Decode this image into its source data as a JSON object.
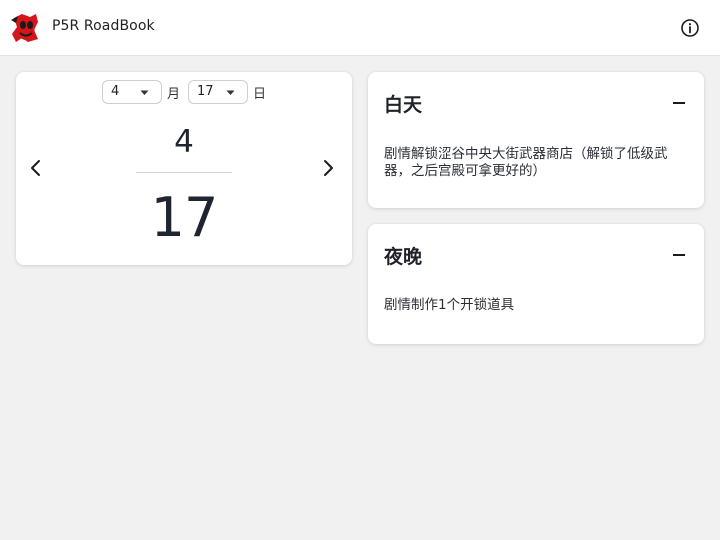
{
  "app": {
    "title": "P5R RoadBook"
  },
  "icons": {
    "logo": "phantom-thieves-calling-card-icon",
    "info": "info-icon",
    "prev": "chevron-left-icon",
    "next": "chevron-right-icon",
    "collapse": "minus-icon",
    "dropdown": "caret-down-icon"
  },
  "colors": {
    "logo_red": "#d5151a",
    "logo_dark": "#1b1b1b",
    "background": "#f1f1f1",
    "card": "#ffffff"
  },
  "date_picker": {
    "month_value": "4",
    "month_unit": "月",
    "day_value": "17",
    "day_unit": "日",
    "display_month": "4",
    "display_day": "17"
  },
  "sections": {
    "daytime": {
      "title": "白天",
      "text": "剧情解锁涩谷中央大街武器商店（解锁了低级武器，之后宫殿可拿更好的）"
    },
    "night": {
      "title": "夜晚",
      "text": "剧情制作1个开锁道具"
    }
  }
}
